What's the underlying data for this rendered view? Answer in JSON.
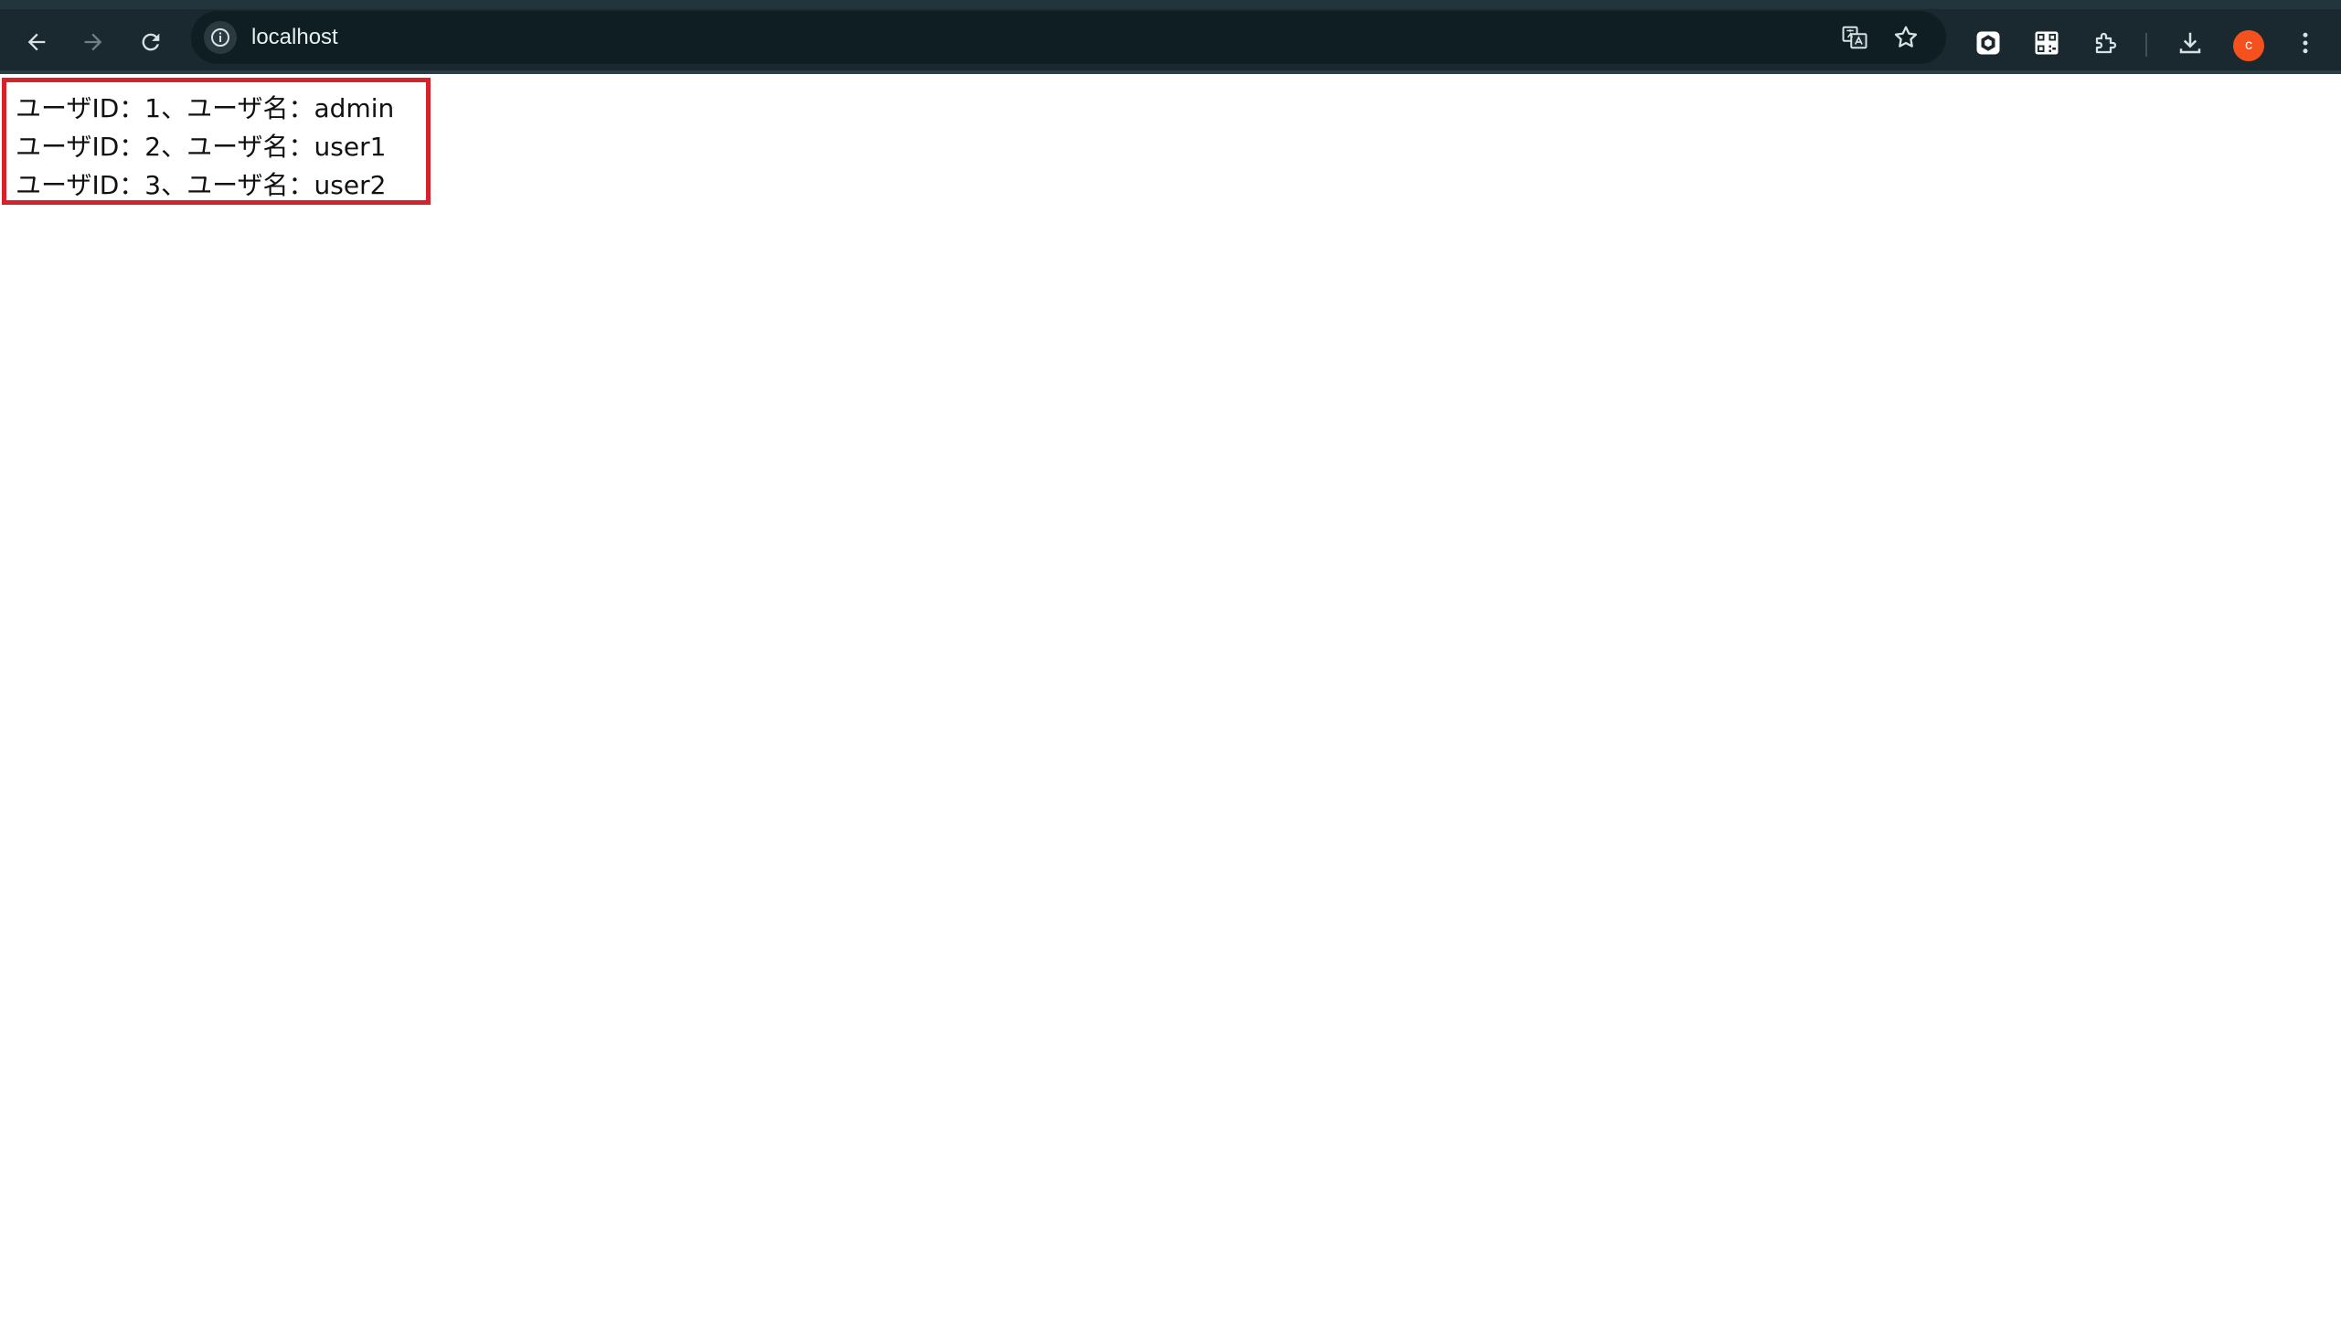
{
  "browser": {
    "url": "localhost",
    "avatar_letter": "c",
    "accent_colors": {
      "toolbar_bg": "#19292f",
      "omnibox_bg": "#0e1e23",
      "avatar_bg": "#f4511e",
      "highlight_border": "#d6222a"
    },
    "icons": {
      "back": "arrow-left-icon",
      "forward": "arrow-right-icon",
      "reload": "reload-icon",
      "site_info": "info-icon",
      "translate": "translate-icon",
      "bookmark": "star-icon",
      "extension_1": "hexagon-extension-icon",
      "extension_2": "qr-code-icon",
      "extensions": "puzzle-icon",
      "downloads": "download-icon",
      "menu": "kebab-menu-icon"
    }
  },
  "page": {
    "users": [
      "ユーザID：1、ユーザ名：admin",
      "ユーザID：2、ユーザ名：user1",
      "ユーザID：3、ユーザ名：user2"
    ]
  }
}
